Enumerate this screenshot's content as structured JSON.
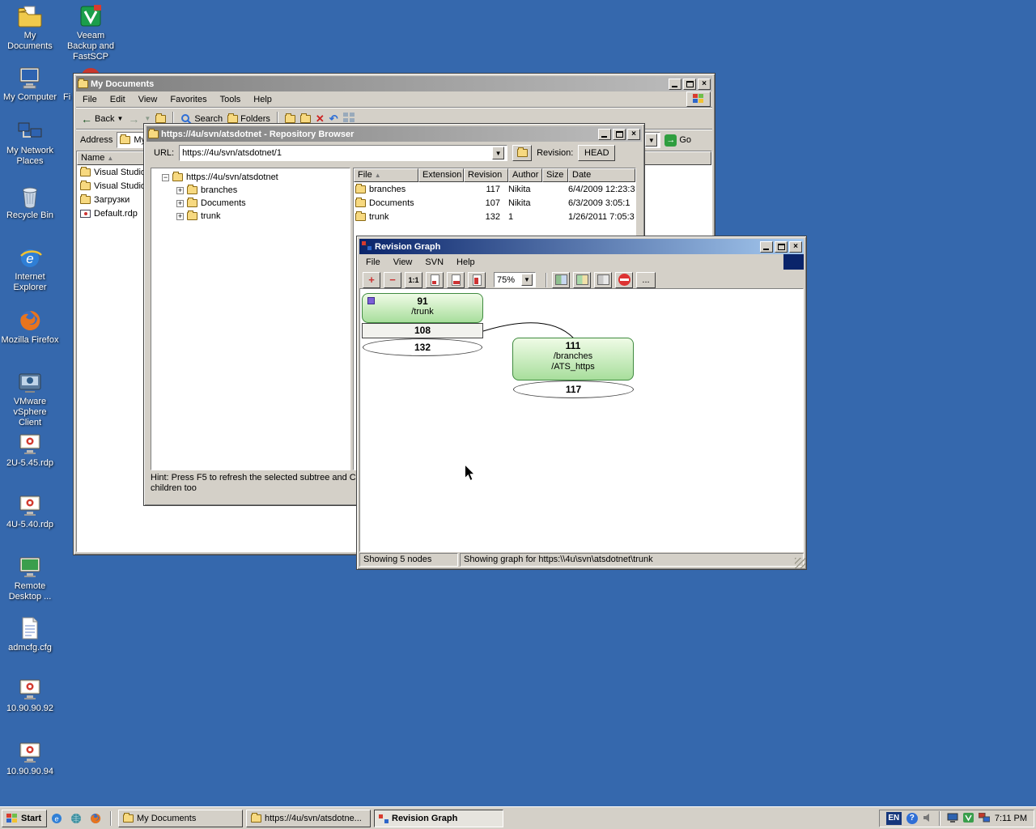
{
  "desktop": {
    "icons": [
      {
        "label": "My Documents"
      },
      {
        "label": "Veeam Backup and FastSCP"
      },
      {
        "label": "My Computer"
      },
      {
        "label": "Fi"
      },
      {
        "label": "My Network Places"
      },
      {
        "label": "Recycle Bin"
      },
      {
        "label": "Internet Explorer"
      },
      {
        "label": "Mozilla Firefox"
      },
      {
        "label": "VMware vSphere Client"
      },
      {
        "label": "2U-5.45.rdp"
      },
      {
        "label": "4U-5.40.rdp"
      },
      {
        "label": "Remote Desktop ..."
      },
      {
        "label": "admcfg.cfg"
      },
      {
        "label": "10.90.90.92"
      },
      {
        "label": "10.90.90.94"
      }
    ]
  },
  "explorer": {
    "title": "My Documents",
    "menu": [
      "File",
      "Edit",
      "View",
      "Favorites",
      "Tools",
      "Help"
    ],
    "back_label": "Back",
    "search_label": "Search",
    "folders_label": "Folders",
    "address_label": "Address",
    "address_value": "My Documents",
    "go_label": "Go",
    "name_header": "Name",
    "items": [
      "Visual Studio",
      "Visual Studio",
      "Загрузки",
      "Default.rdp"
    ],
    "toolbar_icons": [
      "back-icon",
      "forward-icon",
      "up-icon",
      "search-icon",
      "folders-icon",
      "move-icon",
      "copy-icon",
      "delete-icon",
      "undo-icon",
      "views-icon"
    ]
  },
  "repo": {
    "title": "https://4u/svn/atsdotnet - Repository Browser",
    "url_label": "URL:",
    "url_value": "https://4u/svn/atsdotnet/1",
    "revision_label": "Revision:",
    "revision_button": "HEAD",
    "tree": {
      "root": "https://4u/svn/atsdotnet",
      "children": [
        "branches",
        "Documents",
        "trunk"
      ]
    },
    "columns": [
      "File",
      "Extension",
      "Revision",
      "Author",
      "Size",
      "Date"
    ],
    "rows": [
      {
        "file": "branches",
        "revision": "117",
        "author": "Nikita",
        "date": "6/4/2009 12:23:3"
      },
      {
        "file": "Documents",
        "revision": "107",
        "author": "Nikita",
        "date": "6/3/2009 3:05:1"
      },
      {
        "file": "trunk",
        "revision": "132",
        "author": "1",
        "date": "1/26/2011 7:05:3"
      }
    ],
    "hint_line1": "Hint: Press F5 to refresh the selected subtree and C",
    "hint_line2": "children too"
  },
  "graph": {
    "title": "Revision Graph",
    "menu": [
      "File",
      "View",
      "SVN",
      "Help"
    ],
    "one_to_one": "1:1",
    "zoom": "75%",
    "toolbar_ellipsis": "...",
    "toolbar_icons": [
      "zoom-in-icon",
      "zoom-out-icon",
      "actual-size-icon",
      "fit-page-icon",
      "fit-width-icon",
      "fit-height-icon",
      "zoom-combo",
      "compare-revisions-icon",
      "compare-heads-icon",
      "unified-diff-icon",
      "filter-icon",
      "overflow-icon"
    ],
    "nodes": [
      {
        "rev": "91",
        "shape": "roundrect",
        "color": "green",
        "lines": [
          "/trunk"
        ]
      },
      {
        "rev": "108",
        "shape": "rect",
        "lines": []
      },
      {
        "rev": "132",
        "shape": "ellipse",
        "lines": []
      },
      {
        "rev": "111",
        "shape": "roundrect",
        "color": "green",
        "lines": [
          "/branches",
          "/ATS_https"
        ]
      },
      {
        "rev": "117",
        "shape": "ellipse",
        "lines": []
      }
    ],
    "status_nodes": "Showing 5 nodes",
    "status_graph": "Showing graph for https:\\\\4u\\svn\\atsdotnet\\trunk"
  },
  "taskbar": {
    "start": "Start",
    "tasks": [
      {
        "label": "My Documents"
      },
      {
        "label": "https://4u/svn/atsdotne..."
      },
      {
        "label": "Revision Graph",
        "active": true
      }
    ],
    "tray": {
      "lang": "EN",
      "clock": "7:11 PM"
    }
  }
}
